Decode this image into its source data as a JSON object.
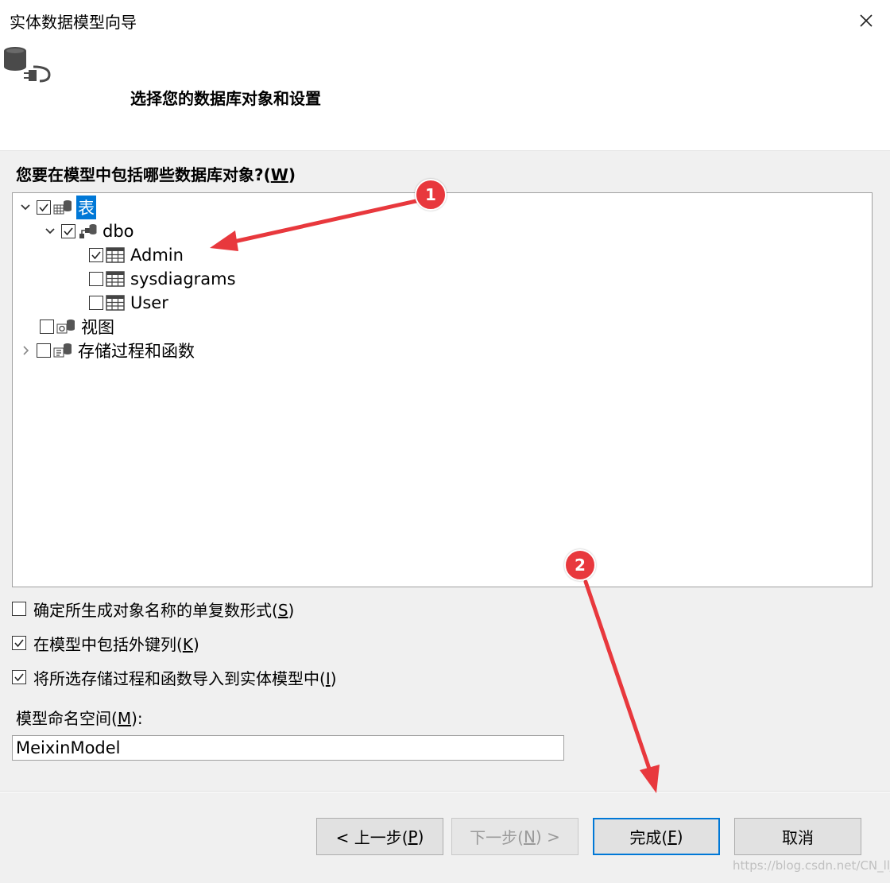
{
  "window": {
    "title": "实体数据模型向导",
    "close_icon": "close-icon"
  },
  "header": {
    "heading": "选择您的数据库对象和设置",
    "icon": "database-plug-icon"
  },
  "objects_prompt": {
    "text_before": "您要在模型中包括哪些数据库对象?(",
    "accel": "W",
    "text_after": ")"
  },
  "tree": {
    "tables": {
      "label": "表",
      "checked": true,
      "expanded": true,
      "icon": "tables-icon"
    },
    "dbo": {
      "label": "dbo",
      "checked": true,
      "expanded": true,
      "icon": "schema-icon"
    },
    "admin": {
      "label": "Admin",
      "checked": true,
      "icon": "table-icon"
    },
    "sysdiagrams": {
      "label": "sysdiagrams",
      "checked": false,
      "icon": "table-icon"
    },
    "user": {
      "label": "User",
      "checked": false,
      "icon": "table-icon"
    },
    "views": {
      "label": "视图",
      "checked": false,
      "icon": "views-icon"
    },
    "procs": {
      "label": "存储过程和函数",
      "checked": false,
      "expanded": false,
      "icon": "procedures-icon"
    }
  },
  "options": {
    "pluralize": {
      "text_before": "确定所生成对象名称的单复数形式(",
      "accel": "S",
      "text_after": ")",
      "checked": false
    },
    "foreign_keys": {
      "text_before": "在模型中包括外键列(",
      "accel": "K",
      "text_after": ")",
      "checked": true
    },
    "import_procs": {
      "text_before": "将所选存储过程和函数导入到实体模型中(",
      "accel": "I",
      "text_after": ")",
      "checked": true
    }
  },
  "namespace": {
    "text_before": "模型命名空间(",
    "accel": "M",
    "text_after": "):",
    "value": "MeixinModel"
  },
  "buttons": {
    "prev": {
      "text_before": "< 上一步(",
      "accel": "P",
      "text_after": ")"
    },
    "next": {
      "text_before": "下一步(",
      "accel": "N",
      "text_after": ") >"
    },
    "finish": {
      "text_before": "完成(",
      "accel": "F",
      "text_after": ")"
    },
    "cancel": {
      "label": "取消"
    }
  },
  "annotations": {
    "badge1": "1",
    "badge2": "2",
    "color": "#e8383d"
  },
  "watermark": "https://blog.csdn.net/CN_llj",
  "colors": {
    "selection": "#0078d7",
    "dialog_bg": "#f0f0f0",
    "header_bg": "#ffffff"
  }
}
